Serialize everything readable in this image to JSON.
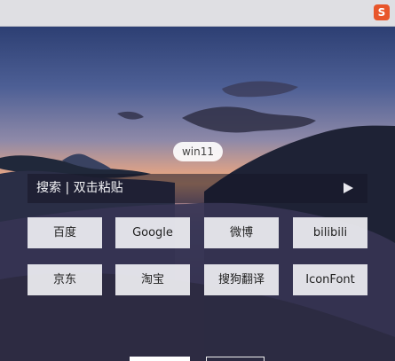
{
  "toolbar": {
    "extension_icon": "s-badge-icon",
    "extension_label": "S"
  },
  "profile": {
    "label": "win11"
  },
  "search": {
    "placeholder": "搜索 | 双击粘贴",
    "submit_icon": "play-arrow-icon"
  },
  "shortcuts": [
    {
      "label": "百度"
    },
    {
      "label": "Google"
    },
    {
      "label": "微博"
    },
    {
      "label": "bilibili"
    },
    {
      "label": "京东"
    },
    {
      "label": "淘宝"
    },
    {
      "label": "搜狗翻译"
    },
    {
      "label": "IconFont"
    }
  ]
}
